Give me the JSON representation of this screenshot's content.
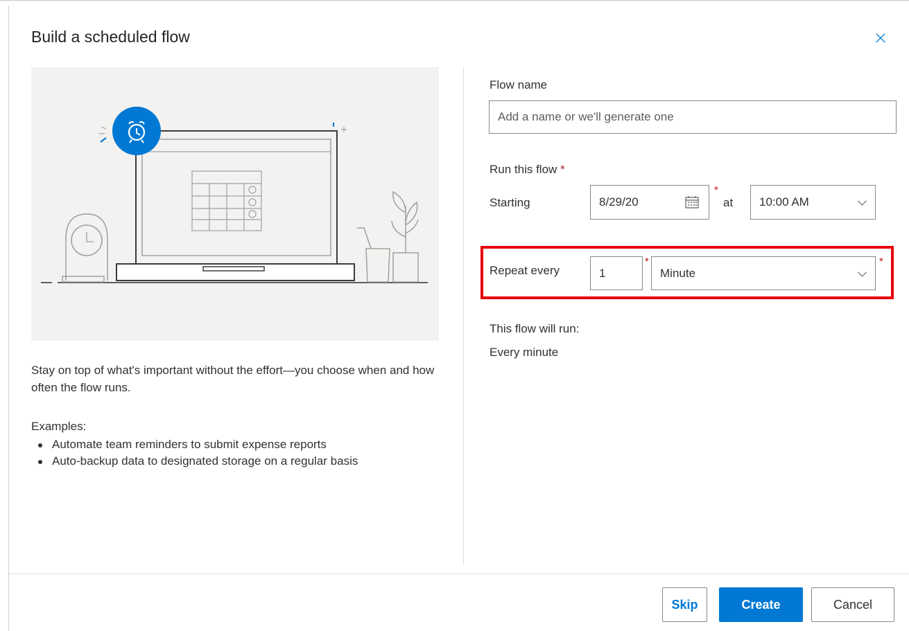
{
  "dialog": {
    "title": "Build a scheduled flow",
    "close_label": "×"
  },
  "left": {
    "description": "Stay on top of what's important without the effort—you choose when and how often the flow runs.",
    "examples_label": "Examples:",
    "examples": [
      "Automate team reminders to submit expense reports",
      "Auto-backup data to designated storage on a regular basis"
    ]
  },
  "form": {
    "flow_name": {
      "label": "Flow name",
      "value": "",
      "placeholder": "Add a name or we'll generate one"
    },
    "run_this_flow": {
      "label": "Run this flow",
      "required_mark": "*",
      "starting_label": "Starting",
      "date_value": "8/29/20",
      "at_label": "at",
      "time_value": "10:00 AM"
    },
    "repeat": {
      "label": "Repeat every",
      "interval_value": "1",
      "unit_value": "Minute"
    },
    "summary": {
      "label": "This flow will run:",
      "value": "Every minute"
    }
  },
  "footer": {
    "skip_label": "Skip",
    "create_label": "Create",
    "cancel_label": "Cancel"
  },
  "colors": {
    "accent": "#0078d4",
    "highlight": "#e8000b",
    "required": "#c50f1f",
    "illustration_bg": "#f3f2f1"
  },
  "icons": [
    "close-icon",
    "alarm-clock-icon",
    "calendar-icon",
    "chevron-down-icon"
  ]
}
